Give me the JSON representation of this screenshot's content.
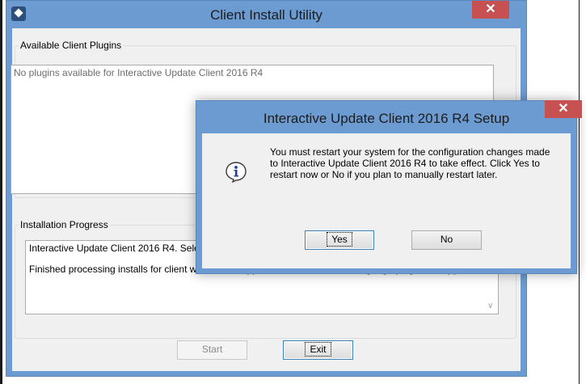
{
  "main_window": {
    "title": "Client Install Utility",
    "close_glyph": "✕",
    "plugins_group_label": "Available Client Plugins",
    "plugins_empty_text": "No plugins available for Interactive Update Client 2016 R4",
    "progress_group_label": "Installation Progress",
    "progress_lines": [
      "Interactive Update Client 2016 R4. Select the client plug-ins and language plug-ins and then click Start.",
      "Finished processing installs for client workstation applications and selected language plug-ins, if applicable."
    ],
    "start_label": "Start",
    "exit_label": "Exit"
  },
  "dialog": {
    "title": "Interactive Update Client 2016 R4 Setup",
    "close_glyph": "✕",
    "icon": "info-icon",
    "message": "You must restart your system for the configuration changes made to Interactive Update Client 2016 R4 to take effect. Click Yes to restart now or No if you plan to manually restart later.",
    "yes_label": "Yes",
    "no_label": "No"
  },
  "colors": {
    "titlebar": "#6b9bd1",
    "close_button": "#c75050",
    "client_area": "#f0f0f0"
  }
}
